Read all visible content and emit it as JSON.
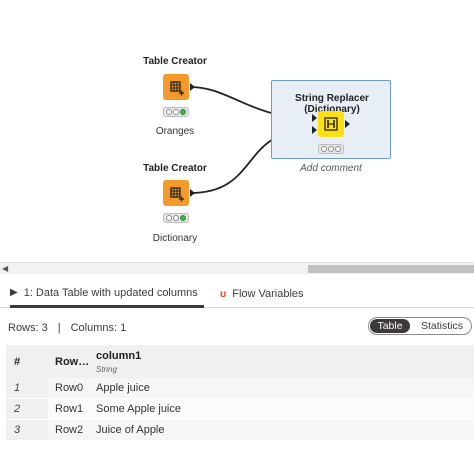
{
  "workflow": {
    "nodes": [
      {
        "id": "table-creator-oranges",
        "title": "Table Creator",
        "label": "Oranges",
        "color": "#f39a2b"
      },
      {
        "id": "table-creator-dictionary",
        "title": "Table Creator",
        "label": "Dictionary",
        "color": "#f39a2b"
      },
      {
        "id": "string-replacer",
        "title": "String Replacer (Dictionary)",
        "label": "Add comment",
        "color": "#fbe112"
      }
    ]
  },
  "scrollbar": {
    "left_arrow": "◀"
  },
  "tabs": {
    "data_table": {
      "glyph": "▶",
      "label": "1: Data Table with updated columns"
    },
    "flow_variables": {
      "glyph": "ʊ",
      "label": "Flow Variables"
    }
  },
  "info": {
    "rows": "Rows: 3",
    "separator": "|",
    "columns": "Columns: 1"
  },
  "view_toggle": {
    "table": "Table",
    "statistics": "Statistics",
    "selected": "Table"
  },
  "table": {
    "headers": {
      "index": "#",
      "row_key": "Row…",
      "column": "column1",
      "column_type": "String"
    },
    "rows": [
      {
        "index": "1",
        "key": "Row0",
        "value": "Apple juice"
      },
      {
        "index": "2",
        "key": "Row1",
        "value": "Some Apple juice"
      },
      {
        "index": "3",
        "key": "Row2",
        "value": "Juice of Apple"
      }
    ]
  }
}
